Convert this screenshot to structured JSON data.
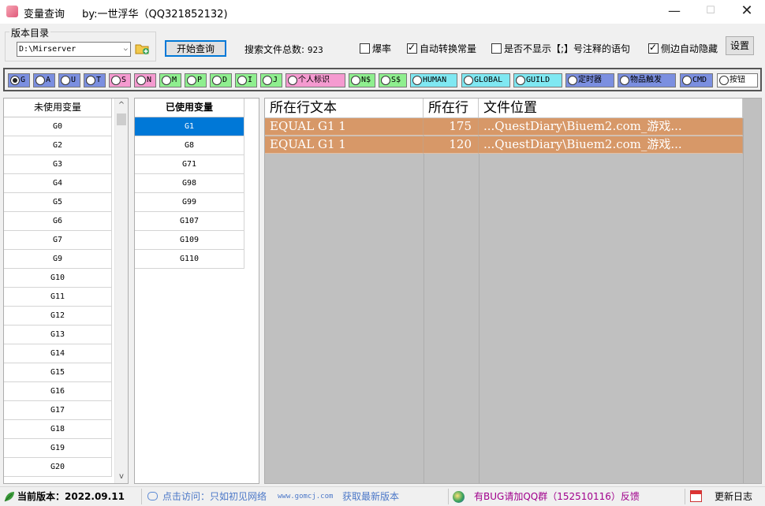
{
  "window": {
    "title": "变量查询",
    "author": "by:一世浮华（QQ321852132)",
    "minimize": "—",
    "maximize": "☐",
    "close": "✕"
  },
  "toolbar": {
    "group_label": "版本目录",
    "dir_value": "D:\\Mirserver",
    "query_button": "开始查询",
    "total_label": "搜索文件总数:",
    "total_value": "923",
    "settings_button": "设置",
    "checkboxes": [
      {
        "label": "爆率",
        "checked": false
      },
      {
        "label": "自动转换常量",
        "checked": true
      },
      {
        "label": "是否不显示【;】号注释的语句",
        "checked": false
      },
      {
        "label": "侧边自动隐藏",
        "checked": true
      }
    ]
  },
  "radios": [
    {
      "label": "G",
      "selected": true,
      "color": "#7b8fe0"
    },
    {
      "label": "A",
      "selected": false,
      "color": "#7b8fe0"
    },
    {
      "label": "U",
      "selected": false,
      "color": "#7b8fe0"
    },
    {
      "label": "T",
      "selected": false,
      "color": "#7b8fe0"
    },
    {
      "label": "S",
      "selected": false,
      "color": "#f59ad0"
    },
    {
      "label": "N",
      "selected": false,
      "color": "#f59ad0"
    },
    {
      "label": "M",
      "selected": false,
      "color": "#8fef8f"
    },
    {
      "label": "P",
      "selected": false,
      "color": "#8fef8f"
    },
    {
      "label": "D",
      "selected": false,
      "color": "#8fef8f"
    },
    {
      "label": "I",
      "selected": false,
      "color": "#8fef8f"
    },
    {
      "label": "J",
      "selected": false,
      "color": "#8fef8f"
    },
    {
      "label": "个人标识",
      "selected": false,
      "color": "#f59ad0"
    },
    {
      "label": "N$",
      "selected": false,
      "color": "#8fef8f"
    },
    {
      "label": "S$",
      "selected": false,
      "color": "#8fef8f"
    },
    {
      "label": "HUMAN",
      "selected": false,
      "color": "#7fe8f2"
    },
    {
      "label": "GLOBAL",
      "selected": false,
      "color": "#7fe8f2"
    },
    {
      "label": "GUILD",
      "selected": false,
      "color": "#7fe8f2"
    },
    {
      "label": "定时器",
      "selected": false,
      "color": "#7b8fe0"
    },
    {
      "label": "物品触发",
      "selected": false,
      "color": "#7b8fe0"
    },
    {
      "label": "CMD",
      "selected": false,
      "color": "#7b8fe0"
    },
    {
      "label": "按钮",
      "selected": false,
      "color": "#ffffff"
    }
  ],
  "unused_list": {
    "header": "未使用变量",
    "items": [
      "G0",
      "G2",
      "G3",
      "G4",
      "G5",
      "G6",
      "G7",
      "G9",
      "G10",
      "G11",
      "G12",
      "G13",
      "G14",
      "G15",
      "G16",
      "G17",
      "G18",
      "G19",
      "G20"
    ],
    "scroll_up": "^",
    "scroll_down": "v"
  },
  "used_list": {
    "header": "已使用变量",
    "items": [
      "G1",
      "G8",
      "G71",
      "G98",
      "G99",
      "G107",
      "G109",
      "G110"
    ],
    "selected_index": 0
  },
  "results": {
    "columns": [
      "所在行文本",
      "所在行",
      "文件位置"
    ],
    "rows": [
      {
        "text": "EQUAL G1 1",
        "line": "175",
        "file": "...QuestDiary\\Biuem2.com_游戏..."
      },
      {
        "text": "EQUAL G1 1",
        "line": "120",
        "file": "...QuestDiary\\Biuem2.com_游戏..."
      }
    ],
    "row_color": "#d79868"
  },
  "statusbar": {
    "version": "当前版本：2022.09.11",
    "visit": "点击访问：只如初见网络",
    "site": "www.gomcj.com",
    "latest": "获取最新版本",
    "bug": "有BUG请加QQ群（152510116）反馈",
    "log": "更新日志"
  }
}
